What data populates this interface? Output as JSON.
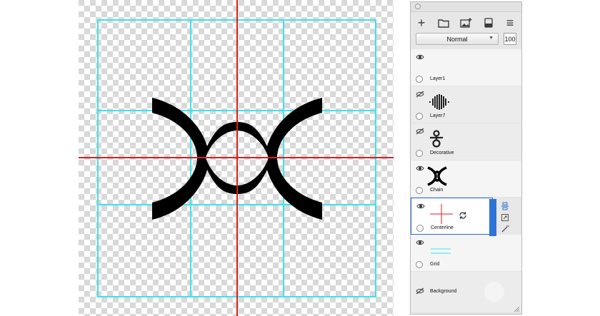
{
  "panel": {
    "blend_mode": "Normal",
    "opacity": "100",
    "toolbar_icons": [
      "add-layer-icon",
      "folder-icon",
      "add-image-icon",
      "flatten-icon",
      "menu-icon"
    ],
    "toolbar_glyphs": {
      "add": "+",
      "menu": "≡"
    }
  },
  "layers": [
    {
      "name": "Layer1",
      "visible": true,
      "thumb": "empty"
    },
    {
      "name": "Layer7",
      "visible": false,
      "thumb": "waveform"
    },
    {
      "name": "Decorative",
      "visible": false,
      "thumb": "decorative-knot"
    },
    {
      "name": "Chain",
      "visible": true,
      "thumb": "chain-symbol"
    },
    {
      "name": "Centerline",
      "visible": true,
      "selected": true,
      "thumb": "red-crosshair"
    },
    {
      "name": "Grid",
      "visible": true,
      "thumb": "cyan-lines"
    },
    {
      "name": "Background",
      "visible": false,
      "thumb": "white-circle"
    }
  ],
  "colors": {
    "grid": "#3fe3ea",
    "centerline": "#e21b1b",
    "artwork": "#000000",
    "checker_light": "#ffffff",
    "checker_dark": "#d9d9d9",
    "selection": "#2e73d6"
  }
}
